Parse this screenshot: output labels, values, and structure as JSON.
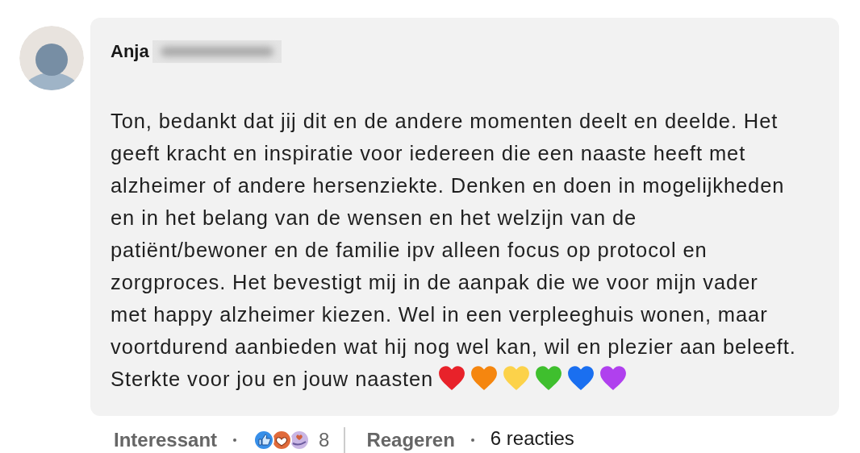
{
  "comment": {
    "author": "Anja",
    "author_hidden": true,
    "text": "Ton, bedankt dat jij dit en de andere momenten deelt en deelde. Het geeft kracht en inspiratie voor iedereen die een naaste heeft met alzheimer of andere hersenziekte. Denken en doen in mogelijkheden en in het belang van de wensen en het welzijn van de patiënt/bewoner en de familie ipv alleen focus op protocol en zorgproces. Het bevestigt mij in de aanpak die we voor mijn vader met happy alzheimer kiezen. Wel in een verpleeghuis wonen, maar voortdurend aanbieden wat hij nog wel kan, wil en plezier aan beleeft. Sterkte voor jou en jouw naasten",
    "hearts": [
      {
        "color": "#e8222a"
      },
      {
        "color": "#f5860f"
      },
      {
        "color": "#fcd24a"
      },
      {
        "color": "#3fbf2e"
      },
      {
        "color": "#1a6ff0"
      },
      {
        "color": "#b040ee"
      }
    ]
  },
  "actions": {
    "react": "Interessant",
    "reaction_count": "8",
    "reply": "Reageren",
    "replies": "6 reacties"
  }
}
